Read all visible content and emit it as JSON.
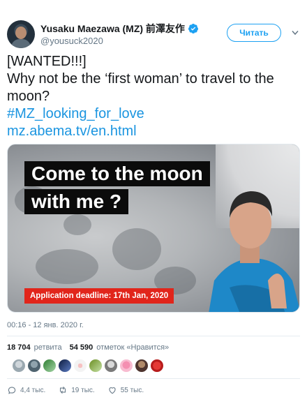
{
  "author": {
    "display_name": "Yusaku Maezawa (MZ) 前澤友作",
    "handle": "@yousuck2020"
  },
  "follow_button": {
    "label": "Читать"
  },
  "tweet": {
    "lines": [
      "[WANTED!!!]",
      "Why not be the ‘first woman’ to travel to the",
      "moon?"
    ],
    "hashtag": "#MZ_looking_for_love",
    "link": "mz.abema.tv/en.html"
  },
  "media": {
    "headline_line1": "Come to the moon",
    "headline_line2": "with me ?",
    "deadline": "Application deadline: 17th Jan, 2020"
  },
  "timestamp": "00:16 - 12 янв. 2020 г.",
  "stats": {
    "retweets_count": "18 704",
    "retweets_label": "ретвита",
    "likes_count": "54 590",
    "likes_label": "отметок «Нравится»"
  },
  "actions": {
    "reply_count": "4,4 тыс.",
    "retweet_count": "19 тыс.",
    "like_count": "55 тыс."
  },
  "colors": {
    "accent": "#1da1f2",
    "link": "#1b95e0",
    "deadline_red": "#e1251b",
    "muted": "#657786"
  },
  "icons": [
    "verified-icon",
    "chevron-down-icon",
    "reply-icon",
    "retweet-icon",
    "like-icon"
  ]
}
